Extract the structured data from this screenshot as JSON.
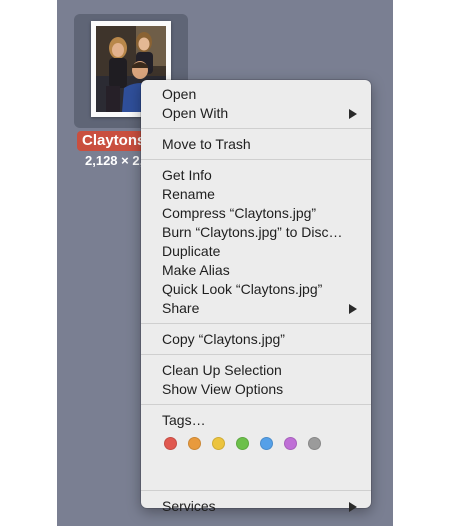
{
  "file": {
    "name_label": "Claytons.jpg",
    "dimensions": "2,128 × 2,832"
  },
  "menu": {
    "groups": [
      [
        {
          "label": "Open",
          "submenu": false
        },
        {
          "label": "Open With",
          "submenu": true
        }
      ],
      [
        {
          "label": "Move to Trash",
          "submenu": false
        }
      ],
      [
        {
          "label": "Get Info",
          "submenu": false
        },
        {
          "label": "Rename",
          "submenu": false
        },
        {
          "label": "Compress “Claytons.jpg”",
          "submenu": false
        },
        {
          "label": "Burn “Claytons.jpg” to Disc…",
          "submenu": false
        },
        {
          "label": "Duplicate",
          "submenu": false
        },
        {
          "label": "Make Alias",
          "submenu": false
        },
        {
          "label": "Quick Look “Claytons.jpg”",
          "submenu": false
        },
        {
          "label": "Share",
          "submenu": true
        }
      ],
      [
        {
          "label": "Copy “Claytons.jpg”",
          "submenu": false
        }
      ],
      [
        {
          "label": "Clean Up Selection",
          "submenu": false
        },
        {
          "label": "Show View Options",
          "submenu": false
        }
      ],
      [
        {
          "label": "Tags…",
          "submenu": false
        }
      ],
      [
        {
          "label": "Services",
          "submenu": true
        }
      ]
    ],
    "tag_colors": [
      {
        "name": "red",
        "color": "#e0584f"
      },
      {
        "name": "orange",
        "color": "#e89a3d"
      },
      {
        "name": "yellow",
        "color": "#ecc43e"
      },
      {
        "name": "green",
        "color": "#6cc04a"
      },
      {
        "name": "blue",
        "color": "#55a0e8"
      },
      {
        "name": "purple",
        "color": "#bf6fd6"
      },
      {
        "name": "gray",
        "color": "#9b9b9b"
      }
    ]
  }
}
